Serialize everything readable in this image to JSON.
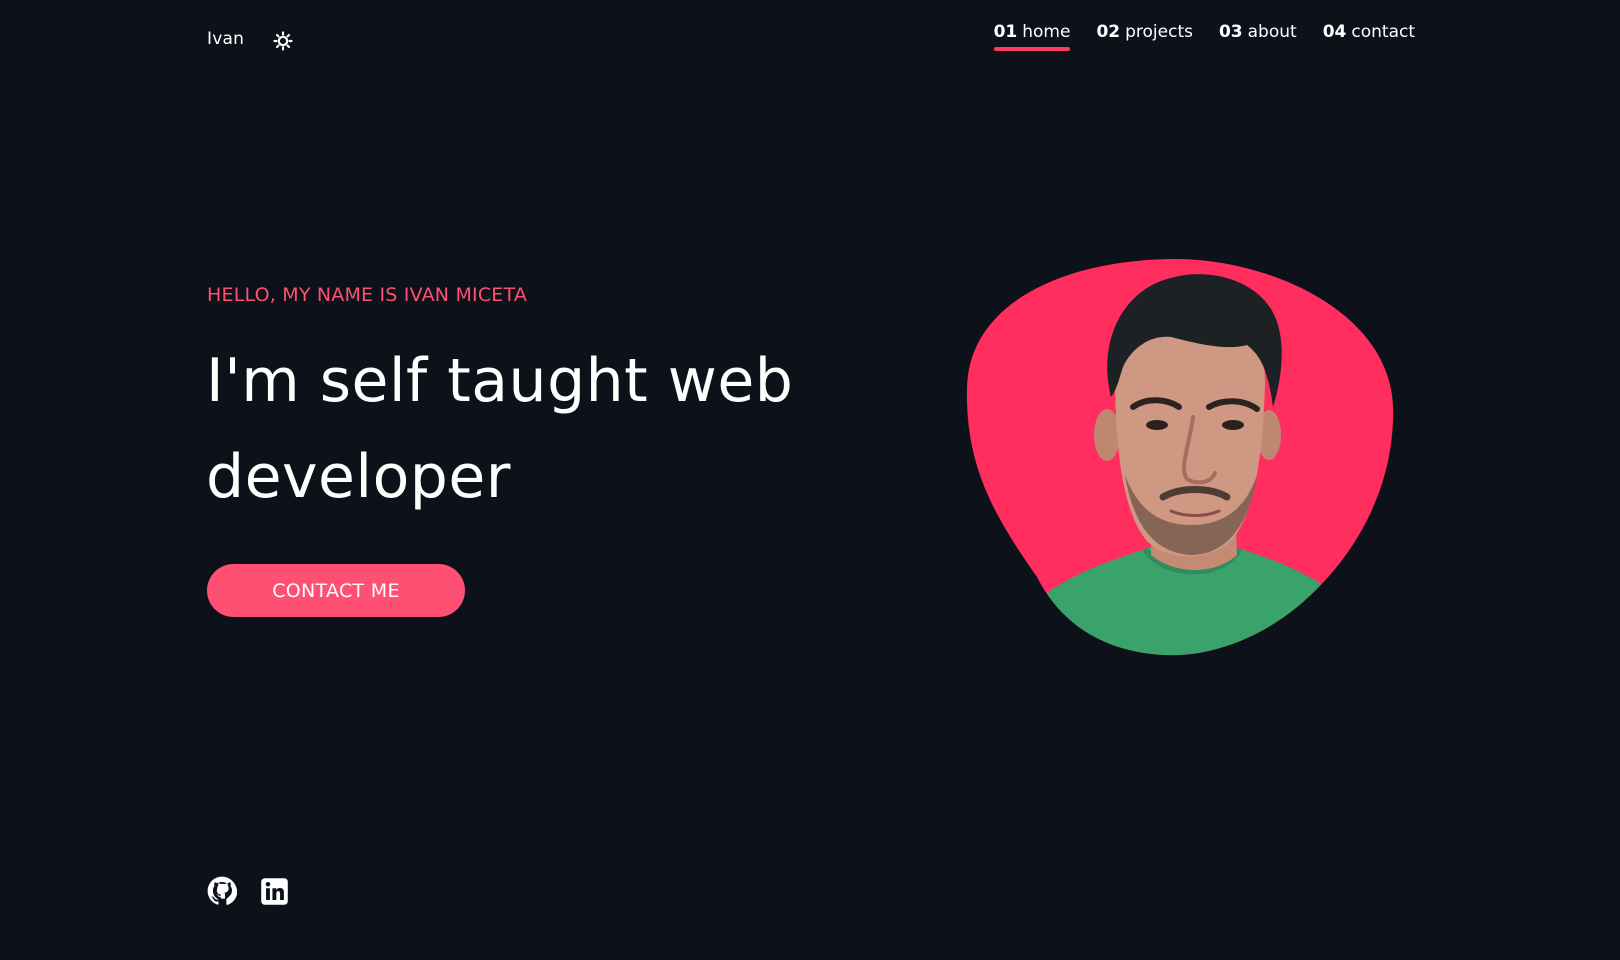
{
  "header": {
    "brand": "Ivan",
    "theme_toggle_icon": "sun-icon",
    "nav": [
      {
        "num": "01",
        "label": "home",
        "active": true
      },
      {
        "num": "02",
        "label": "projects",
        "active": false
      },
      {
        "num": "03",
        "label": "about",
        "active": false
      },
      {
        "num": "04",
        "label": "contact",
        "active": false
      }
    ]
  },
  "hero": {
    "eyebrow": "HELLO, MY NAME IS IVAN MICETA",
    "headline": "I'm self taught web developer",
    "cta_label": "CONTACT ME"
  },
  "portrait": {
    "icon": "profile-photo"
  },
  "social": [
    {
      "icon": "github-icon"
    },
    {
      "icon": "linkedin-icon"
    }
  ],
  "colors": {
    "background": "#0d121a",
    "accent": "#ff4f72",
    "blob": "#ff2e5f",
    "text": "#ffffff"
  }
}
